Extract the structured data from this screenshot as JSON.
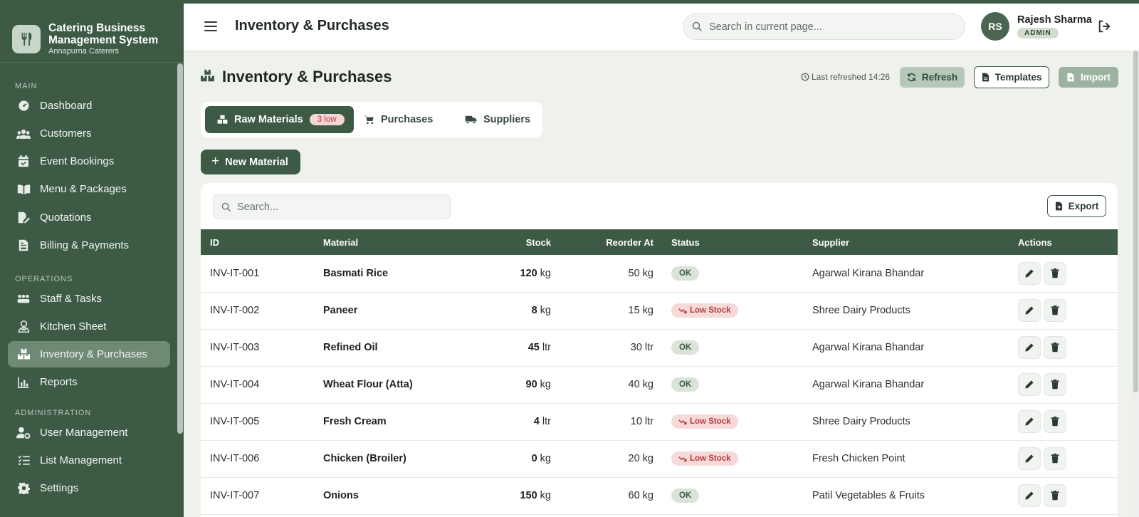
{
  "brand": {
    "title_line1": "Catering Business",
    "title_line2": "Management System",
    "subtitle": "Annapurna Caterers"
  },
  "sidebar": {
    "sections": [
      "MAIN",
      "OPERATIONS",
      "ADMINISTRATION"
    ],
    "items": [
      {
        "label": "Dashboard",
        "icon": "dashboard-icon"
      },
      {
        "label": "Customers",
        "icon": "users-icon"
      },
      {
        "label": "Event Bookings",
        "icon": "calendar-icon"
      },
      {
        "label": "Menu & Packages",
        "icon": "book-icon"
      },
      {
        "label": "Quotations",
        "icon": "file-signature-icon"
      },
      {
        "label": "Billing & Payments",
        "icon": "invoice-icon"
      },
      {
        "label": "Staff & Tasks",
        "icon": "team-icon"
      },
      {
        "label": "Kitchen Sheet",
        "icon": "chef-icon"
      },
      {
        "label": "Inventory & Purchases",
        "icon": "boxes-icon",
        "active": true
      },
      {
        "label": "Reports",
        "icon": "chart-icon"
      },
      {
        "label": "User Management",
        "icon": "user-gear-icon"
      },
      {
        "label": "List Management",
        "icon": "list-icon"
      },
      {
        "label": "Settings",
        "icon": "gear-icon"
      }
    ]
  },
  "header": {
    "title": "Inventory & Purchases",
    "search_placeholder": "Search in current page...",
    "user": {
      "initials": "RS",
      "name": "Rajesh Sharma",
      "role": "ADMIN"
    }
  },
  "page": {
    "title": "Inventory & Purchases",
    "last_refreshed": "Last refreshed 14:26",
    "buttons": {
      "refresh": "Refresh",
      "templates": "Templates",
      "import": "Import",
      "new": "New Material",
      "export": "Export"
    },
    "tabs": [
      {
        "label": "Raw Materials",
        "badge": "3 low",
        "active": true
      },
      {
        "label": "Purchases"
      },
      {
        "label": "Suppliers"
      }
    ],
    "table_search_placeholder": "Search..."
  },
  "table": {
    "columns": [
      "ID",
      "Material",
      "Stock",
      "Reorder At",
      "Status",
      "Supplier",
      "Actions"
    ],
    "rows": [
      {
        "id": "INV-IT-001",
        "material": "Basmati Rice",
        "stock": "120",
        "stock_unit": "kg",
        "reorder": "50 kg",
        "status": "OK",
        "supplier": "Agarwal Kirana Bhandar"
      },
      {
        "id": "INV-IT-002",
        "material": "Paneer",
        "stock": "8",
        "stock_unit": "kg",
        "reorder": "15 kg",
        "status": "Low Stock",
        "supplier": "Shree Dairy Products"
      },
      {
        "id": "INV-IT-003",
        "material": "Refined Oil",
        "stock": "45",
        "stock_unit": "ltr",
        "reorder": "30 ltr",
        "status": "OK",
        "supplier": "Agarwal Kirana Bhandar"
      },
      {
        "id": "INV-IT-004",
        "material": "Wheat Flour (Atta)",
        "stock": "90",
        "stock_unit": "kg",
        "reorder": "40 kg",
        "status": "OK",
        "supplier": "Agarwal Kirana Bhandar"
      },
      {
        "id": "INV-IT-005",
        "material": "Fresh Cream",
        "stock": "4",
        "stock_unit": "ltr",
        "reorder": "10 ltr",
        "status": "Low Stock",
        "supplier": "Shree Dairy Products"
      },
      {
        "id": "INV-IT-006",
        "material": "Chicken (Broiler)",
        "stock": "0",
        "stock_unit": "kg",
        "reorder": "20 kg",
        "status": "Low Stock",
        "supplier": "Fresh Chicken Point"
      },
      {
        "id": "INV-IT-007",
        "material": "Onions",
        "stock": "150",
        "stock_unit": "kg",
        "reorder": "60 kg",
        "status": "OK",
        "supplier": "Patil Vegetables & Fruits"
      }
    ]
  },
  "colors": {
    "primary": "#3d5a45",
    "low_stock": "#b83b3b",
    "ok": "#3d5a45"
  }
}
